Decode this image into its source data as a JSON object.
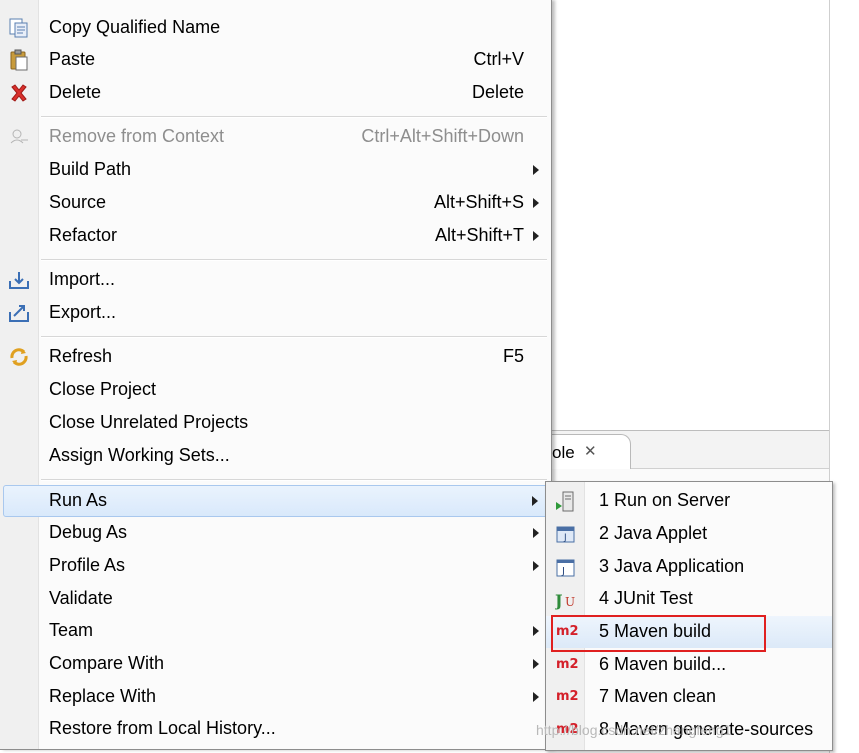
{
  "context_menu": {
    "items": [
      {
        "label": "Copy Qualified Name",
        "accel": "",
        "icon": "copy-qualified-name-icon"
      },
      {
        "label": "Paste",
        "accel": "Ctrl+V",
        "icon": "paste-icon"
      },
      {
        "label": "Delete",
        "accel": "Delete",
        "icon": "delete-icon"
      },
      {
        "label": "Remove from Context",
        "accel": "Ctrl+Alt+Shift+Down",
        "icon": "remove-context-icon",
        "disabled": true
      },
      {
        "label": "Build Path",
        "accel": "",
        "submenu": true
      },
      {
        "label": "Source",
        "accel": "Alt+Shift+S",
        "submenu": true
      },
      {
        "label": "Refactor",
        "accel": "Alt+Shift+T",
        "submenu": true
      },
      {
        "label": "Import...",
        "accel": "",
        "icon": "import-icon"
      },
      {
        "label": "Export...",
        "accel": "",
        "icon": "export-icon"
      },
      {
        "label": "Refresh",
        "accel": "F5",
        "icon": "refresh-icon"
      },
      {
        "label": "Close Project",
        "accel": ""
      },
      {
        "label": "Close Unrelated Projects",
        "accel": ""
      },
      {
        "label": "Assign Working Sets...",
        "accel": ""
      },
      {
        "label": "Run As",
        "accel": "",
        "submenu": true,
        "highlighted": true
      },
      {
        "label": "Debug As",
        "accel": "",
        "submenu": true
      },
      {
        "label": "Profile As",
        "accel": "",
        "submenu": true
      },
      {
        "label": "Validate",
        "accel": ""
      },
      {
        "label": "Team",
        "accel": "",
        "submenu": true
      },
      {
        "label": "Compare With",
        "accel": "",
        "submenu": true
      },
      {
        "label": "Replace With",
        "accel": "",
        "submenu": true
      },
      {
        "label": "Restore from Local History...",
        "accel": ""
      }
    ]
  },
  "run_as_submenu": {
    "items": [
      {
        "label": "1 Run on Server",
        "icon": "run-on-server-icon"
      },
      {
        "label": "2 Java Applet",
        "icon": "java-applet-icon"
      },
      {
        "label": "3 Java Application",
        "icon": "java-application-icon"
      },
      {
        "label": "4 JUnit Test",
        "icon": "junit-icon",
        "icon_text": "Ju"
      },
      {
        "label": "5 Maven build",
        "icon": "maven-icon",
        "icon_text": "m2",
        "selected": true
      },
      {
        "label": "6 Maven build...",
        "icon": "maven-icon",
        "icon_text": "m2"
      },
      {
        "label": "7 Maven clean",
        "icon": "maven-icon",
        "icon_text": "m2"
      },
      {
        "label": "8 Maven generate-sources",
        "icon": "maven-icon",
        "icon_text": "m2"
      }
    ]
  },
  "console_tab": {
    "label": "ole",
    "close_glyph": "✕"
  },
  "watermark": "http://blog.csdn.net/zhangfeng1",
  "colors": {
    "highlight": "#d9e9fb",
    "annotation_box": "#e02020",
    "maven": "#d4202a",
    "junit_j": "#2e8b3a",
    "junit_u": "#c0392b"
  }
}
